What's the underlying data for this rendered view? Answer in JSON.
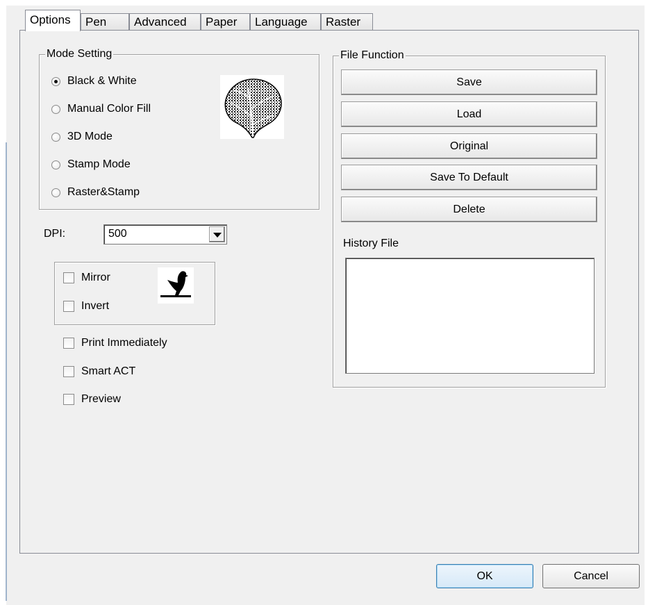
{
  "tabs": [
    {
      "label": "Options",
      "active": true
    },
    {
      "label": "Pen"
    },
    {
      "label": "Advanced"
    },
    {
      "label": "Paper"
    },
    {
      "label": "Language"
    },
    {
      "label": "Raster"
    }
  ],
  "mode_setting": {
    "title": "Mode Setting",
    "options": [
      {
        "label": "Black & White",
        "checked": true
      },
      {
        "label": "Manual Color Fill",
        "checked": false
      },
      {
        "label": "3D Mode",
        "checked": false
      },
      {
        "label": "Stamp Mode",
        "checked": false
      },
      {
        "label": "Raster&Stamp",
        "checked": false
      }
    ],
    "preview_icon": "leaf-sketch-icon"
  },
  "dpi": {
    "label": "DPI:",
    "value": "500"
  },
  "image_options": {
    "mirror": {
      "label": "Mirror",
      "checked": false
    },
    "invert": {
      "label": "Invert",
      "checked": false
    },
    "preview_icon": "bird-silhouette-icon"
  },
  "checkboxes": [
    {
      "label": "Print Immediately",
      "checked": false
    },
    {
      "label": "Smart ACT",
      "checked": false
    },
    {
      "label": "Preview",
      "checked": false
    }
  ],
  "file_function": {
    "title": "File Function",
    "buttons": [
      "Save",
      "Load",
      "Original",
      "Save To Default",
      "Delete"
    ],
    "history_label": "History File"
  },
  "footer": {
    "ok": "OK",
    "cancel": "Cancel"
  }
}
